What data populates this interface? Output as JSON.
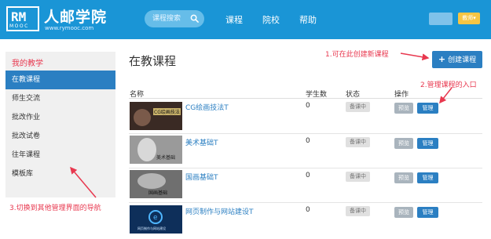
{
  "header": {
    "logo_glyph": "RM",
    "logo_sub": "MOOC",
    "brand": "人邮学院",
    "brand_url": "www.rymooc.com",
    "search_placeholder": "课程搜索",
    "nav": [
      "课程",
      "院校",
      "帮助"
    ],
    "user_badge": "教师"
  },
  "sidebar": {
    "title": "我的教学",
    "items": [
      {
        "label": "在教课程",
        "active": true
      },
      {
        "label": "师生交流",
        "active": false
      },
      {
        "label": "批改作业",
        "active": false
      },
      {
        "label": "批改试卷",
        "active": false
      },
      {
        "label": "往年课程",
        "active": false
      },
      {
        "label": "模板库",
        "active": false
      }
    ]
  },
  "main": {
    "title": "在教课程",
    "create_button": "创建课程",
    "columns": [
      "名称",
      "学生数",
      "状态",
      "操作"
    ],
    "courses": [
      {
        "name": "CG绘画技法T",
        "students": "0",
        "status": "备课中",
        "thumb_text": "CG绘画技法",
        "thumb_bg": "#3a2a24"
      },
      {
        "name": "美术基础T",
        "students": "0",
        "status": "备课中",
        "thumb_text": "美术基础",
        "thumb_bg": "#9a9a9a"
      },
      {
        "name": "国画基础T",
        "students": "0",
        "status": "备课中",
        "thumb_text": "国画基础",
        "thumb_bg": "#6f6f6f"
      },
      {
        "name": "网页制作与网站建设T",
        "students": "0",
        "status": "备课中",
        "thumb_text": "网页制作与网站建设",
        "thumb_bg": "#0e2f5a"
      }
    ],
    "preview_label": "预览",
    "manage_label": "管理"
  },
  "annotations": {
    "create": "1.可在此创建新课程",
    "manage": "2.管理课程的入口",
    "nav": "3.切换到其他管理界面的导航"
  },
  "colors": {
    "header_bg": "#1a95d6",
    "primary": "#2b7fc2",
    "annotation": "#e8384f",
    "badge": "#f6c544"
  }
}
